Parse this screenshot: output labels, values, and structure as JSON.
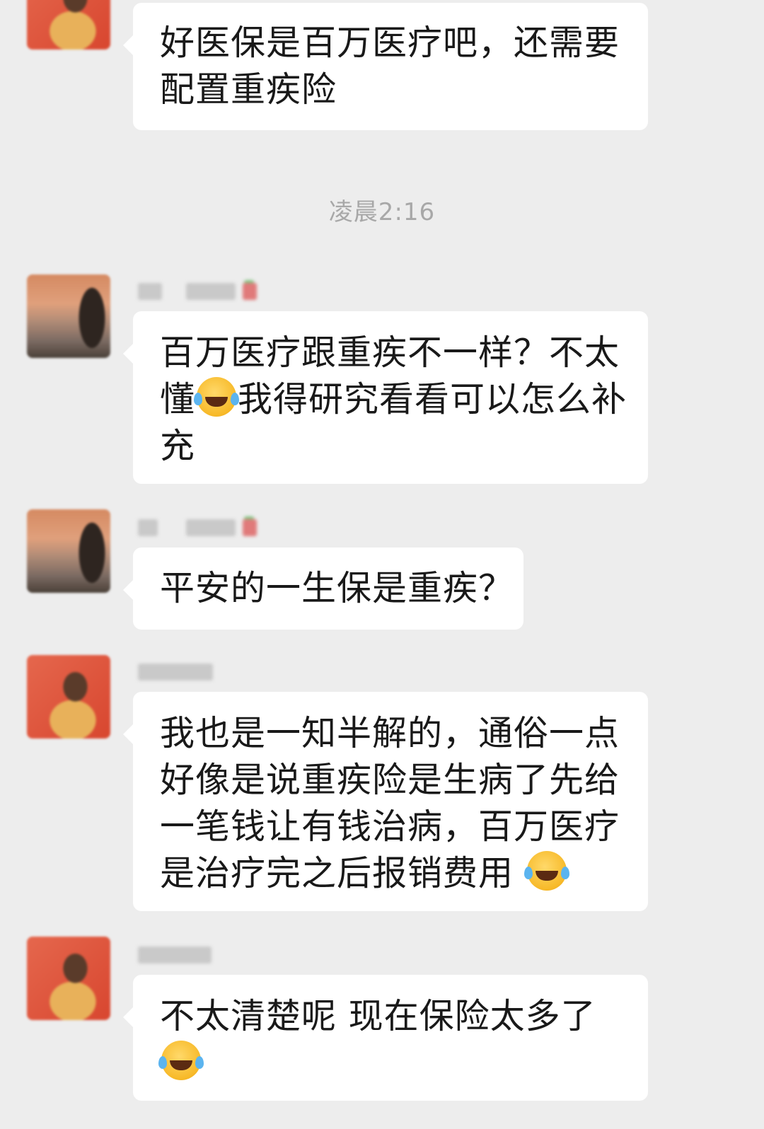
{
  "conversation": {
    "timestamp": "凌晨2:16",
    "messages": [
      {
        "sender_name": "",
        "avatar": "blurred-avatar",
        "lines": [
          "好医保是百万医疗吧，还需要",
          "配置重疾险"
        ]
      },
      {
        "sender_name": "",
        "avatar": "blurred-avatar",
        "lines": [
          "百万医疗跟重疾不一样？不太",
          "懂",
          "我得研究看看可以怎么补",
          "充"
        ],
        "emoji": "facepalm-emoji"
      },
      {
        "sender_name": "",
        "avatar": "blurred-avatar",
        "lines": [
          "平安的一生保是重疾？"
        ]
      },
      {
        "sender_name": "",
        "avatar": "blurred-avatar",
        "lines": [
          "我也是一知半解的，通俗一点",
          "好像是说重疾险是生病了先给",
          "一笔钱让有钱治病，百万医疗",
          "是治疗完之后报销费用 "
        ],
        "emoji": "tears-of-joy-emoji"
      },
      {
        "sender_name": "",
        "avatar": "blurred-avatar",
        "lines": [
          "不太清楚呢 现在保险太多了"
        ],
        "emoji": "tears-of-joy-emoji"
      }
    ]
  },
  "colors": {
    "background": "#ededed",
    "bubble": "#ffffff",
    "timestamp_text": "#a8a8a8",
    "message_text": "#191919"
  }
}
